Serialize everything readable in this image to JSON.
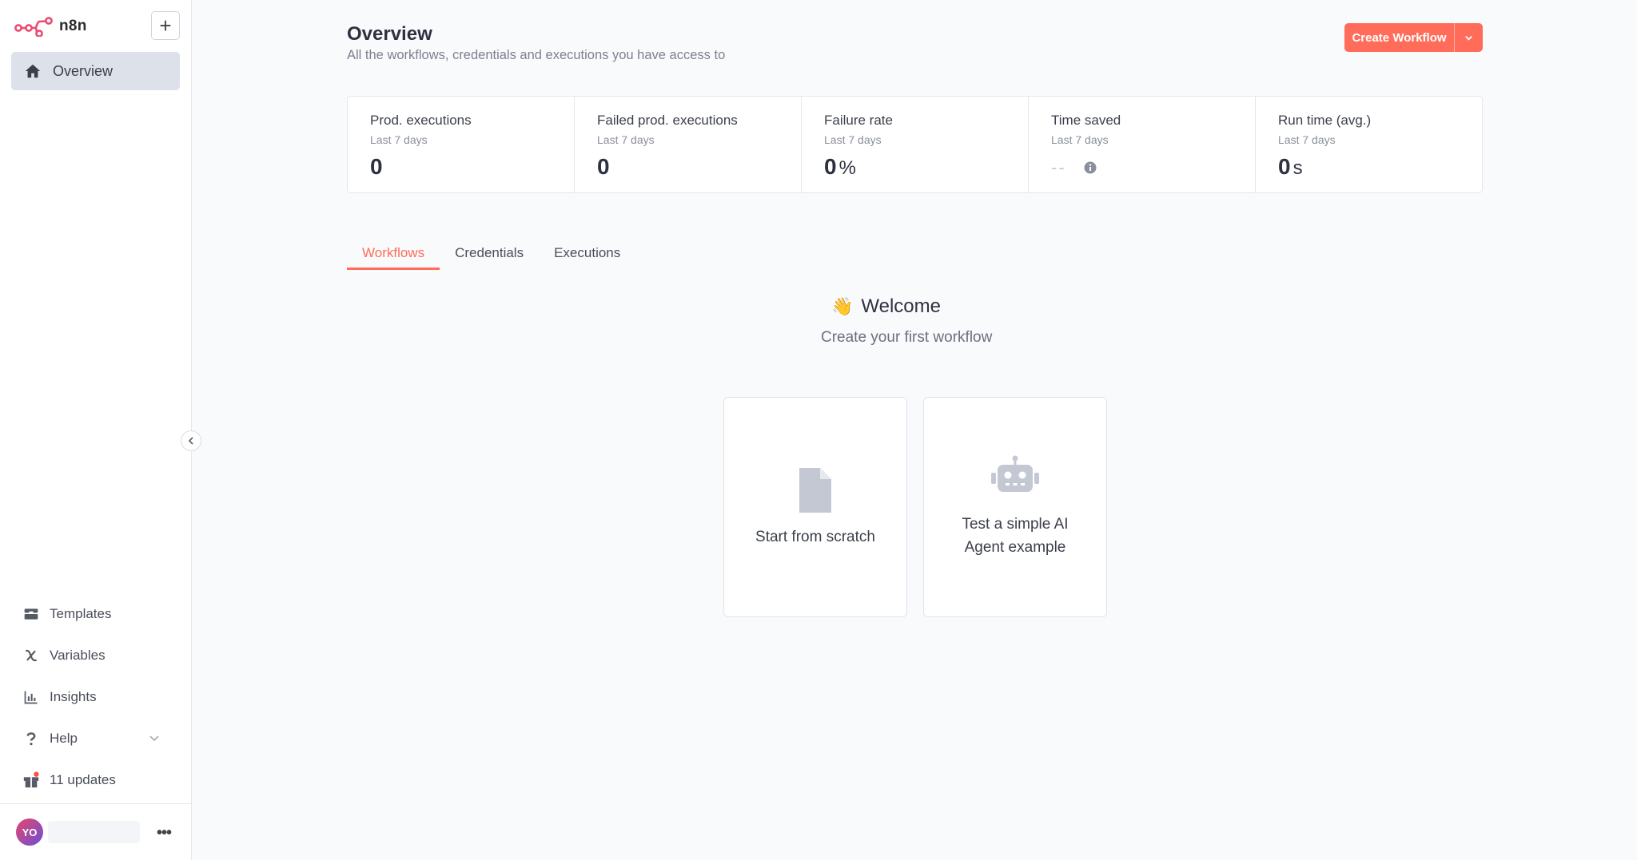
{
  "app": {
    "logo_text": "n8n"
  },
  "sidebar": {
    "add_label": "+",
    "overview_label": "Overview",
    "bottom_items": [
      {
        "label": "Templates"
      },
      {
        "label": "Variables"
      },
      {
        "label": "Insights"
      },
      {
        "label": "Help"
      },
      {
        "label": "11 updates"
      }
    ],
    "user_initials": "YO",
    "more_label": "•••"
  },
  "header": {
    "title": "Overview",
    "subtitle": "All the workflows, credentials and executions you have access to",
    "create_label": "Create Workflow"
  },
  "stats": [
    {
      "title": "Prod. executions",
      "period": "Last 7 days",
      "value": "0",
      "unit": ""
    },
    {
      "title": "Failed prod. executions",
      "period": "Last 7 days",
      "value": "0",
      "unit": ""
    },
    {
      "title": "Failure rate",
      "period": "Last 7 days",
      "value": "0",
      "unit": "%"
    },
    {
      "title": "Time saved",
      "period": "Last 7 days",
      "value": "--",
      "unit": ""
    },
    {
      "title": "Run time (avg.)",
      "period": "Last 7 days",
      "value": "0",
      "unit": "s"
    }
  ],
  "tabs": [
    {
      "label": "Workflows",
      "active": true
    },
    {
      "label": "Credentials",
      "active": false
    },
    {
      "label": "Executions",
      "active": false
    }
  ],
  "empty_state": {
    "wave": "👋",
    "welcome": "Welcome",
    "subtitle": "Create your first workflow",
    "cards": [
      {
        "label": "Start from scratch",
        "icon": "file-icon"
      },
      {
        "label": "Test a simple AI Agent example",
        "icon": "robot-icon"
      }
    ]
  },
  "colors": {
    "accent": "#ff6d5a",
    "sidebar_active_bg": "#dde1ea",
    "page_bg": "#f9fafc",
    "notification_dot": "#ff4d4d"
  }
}
